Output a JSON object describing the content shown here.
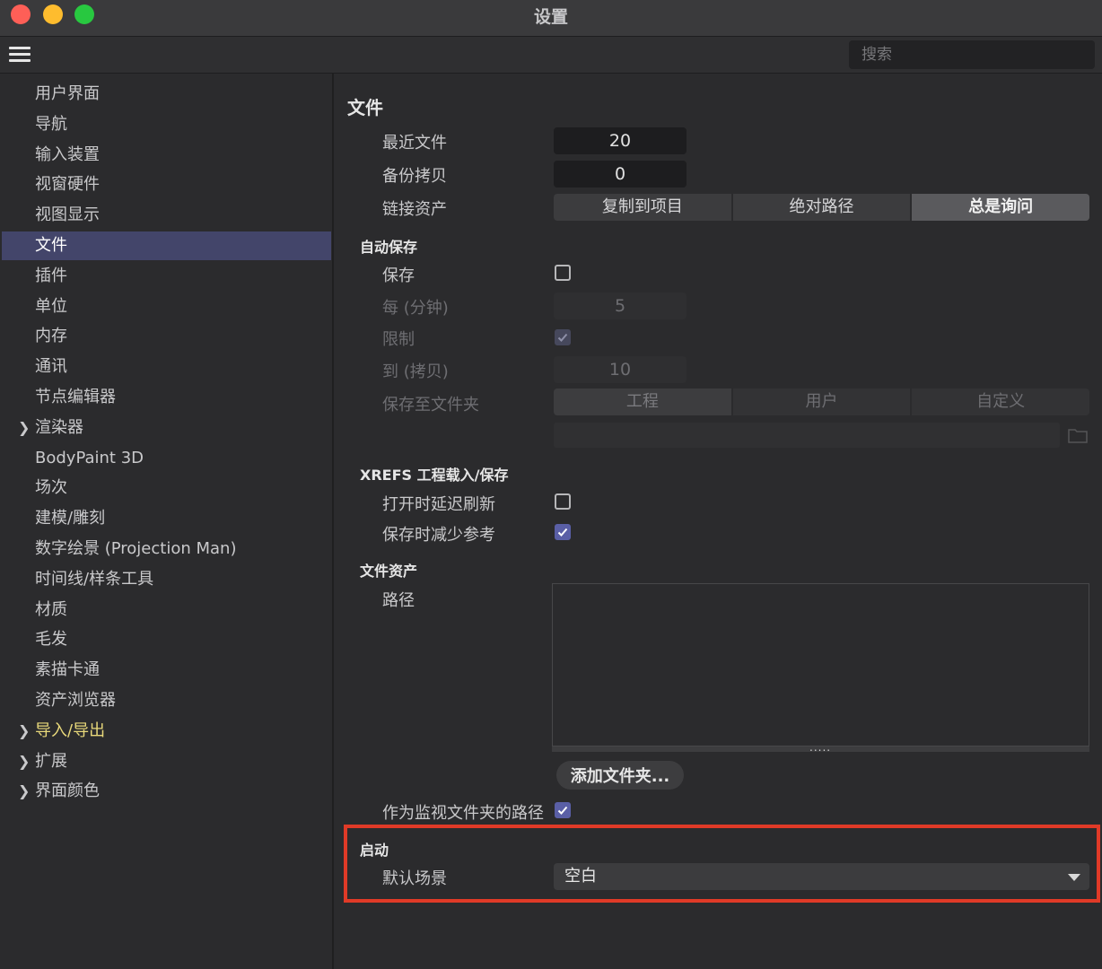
{
  "window": {
    "title": "设置"
  },
  "toolbar": {
    "search_placeholder": "搜索",
    "menu_icon": "hamburger-icon"
  },
  "sidebar": {
    "items": [
      {
        "label": "用户界面"
      },
      {
        "label": "导航"
      },
      {
        "label": "输入装置"
      },
      {
        "label": "视窗硬件"
      },
      {
        "label": "视图显示"
      },
      {
        "label": "文件",
        "active": true
      },
      {
        "label": "插件"
      },
      {
        "label": "单位"
      },
      {
        "label": "内存"
      },
      {
        "label": "通讯"
      },
      {
        "label": "节点编辑器"
      },
      {
        "label": "渲染器",
        "expandable": true
      },
      {
        "label": "BodyPaint 3D"
      },
      {
        "label": "场次"
      },
      {
        "label": "建模/雕刻"
      },
      {
        "label": "数字绘景 (Projection Man)"
      },
      {
        "label": "时间线/样条工具"
      },
      {
        "label": "材质"
      },
      {
        "label": "毛发"
      },
      {
        "label": "素描卡通"
      },
      {
        "label": "资产浏览器"
      },
      {
        "label": "导入/导出",
        "expandable": true,
        "highlight_color": "#e8d87a"
      },
      {
        "label": "扩展",
        "expandable": true
      },
      {
        "label": "界面颜色",
        "expandable": true
      }
    ]
  },
  "main": {
    "title": "文件",
    "recent_files": {
      "label": "最近文件",
      "value": "20"
    },
    "backup_copies": {
      "label": "备份拷贝",
      "value": "0"
    },
    "link_assets": {
      "label": "链接资产",
      "options": [
        "复制到项目",
        "绝对路径",
        "总是询问"
      ],
      "selected": "总是询问"
    },
    "autosave": {
      "title": "自动保存",
      "save": {
        "label": "保存",
        "checked": false
      },
      "every": {
        "label": "每 (分钟)",
        "value": "5"
      },
      "limit": {
        "label": "限制",
        "checked": true
      },
      "to": {
        "label": "到 (拷贝)",
        "value": "10"
      },
      "save_to_folder": {
        "label": "保存至文件夹",
        "options": [
          "工程",
          "用户",
          "自定义"
        ],
        "selected": "工程"
      }
    },
    "xrefs": {
      "title": "XREFS 工程载入/保存",
      "delay_refresh": {
        "label": "打开时延迟刷新",
        "checked": false
      },
      "reduce_refs": {
        "label": "保存时减少参考",
        "checked": true
      }
    },
    "file_assets": {
      "title": "文件资产",
      "path_label": "路径",
      "handle_dots": ".....",
      "add_folder_button": "添加文件夹...",
      "watch_folder": {
        "label": "作为监视文件夹的路径",
        "checked": true
      }
    },
    "startup": {
      "title": "启动",
      "default_scene": {
        "label": "默认场景",
        "value": "空白"
      }
    }
  },
  "colors": {
    "accent": "#5a5fa6",
    "selected_sidebar": "#43456a",
    "highlight_box": "#e03a27"
  }
}
